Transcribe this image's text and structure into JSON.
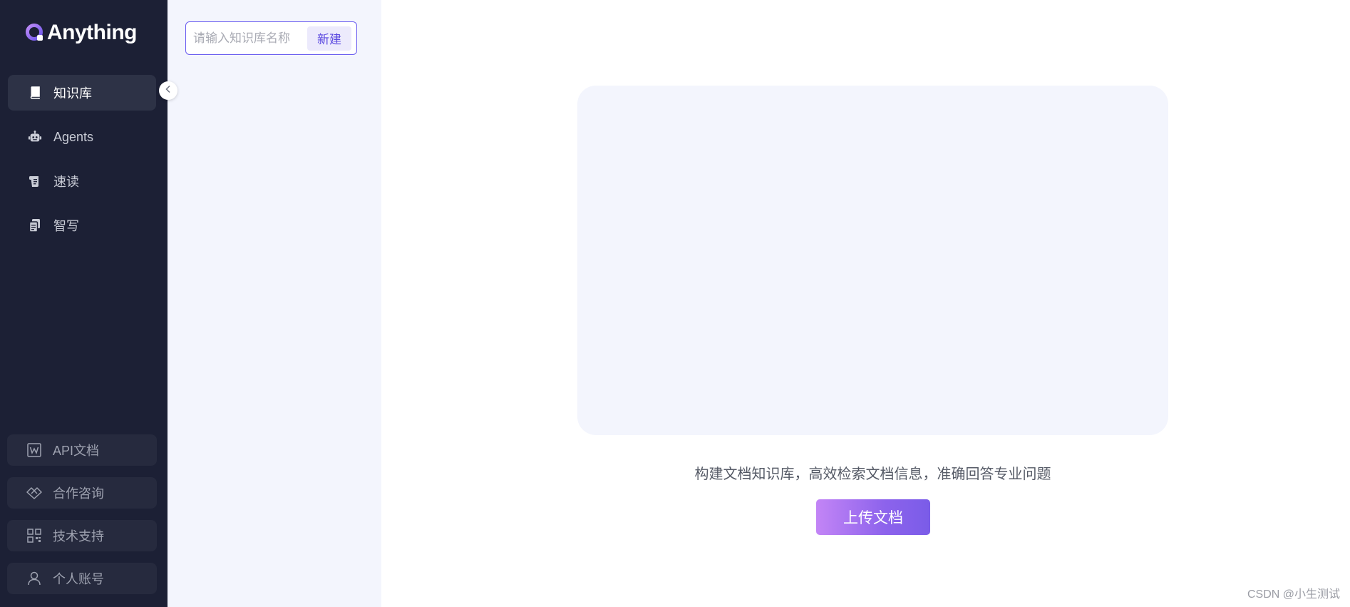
{
  "app": {
    "logo_text": "Anything",
    "brand_color": "#7a5ce8",
    "sidebar_bg": "#1c2035"
  },
  "sidebar": {
    "items": [
      {
        "label": "知识库",
        "icon": "book-icon",
        "active": true
      },
      {
        "label": "Agents",
        "icon": "robot-icon",
        "active": false
      },
      {
        "label": "速读",
        "icon": "scroll-icon",
        "active": false
      },
      {
        "label": "智写",
        "icon": "documents-icon",
        "active": false
      }
    ],
    "bottom_items": [
      {
        "label": "API文档",
        "icon": "word-doc-icon"
      },
      {
        "label": "合作咨询",
        "icon": "handshake-icon"
      },
      {
        "label": "技术支持",
        "icon": "qrcode-icon"
      },
      {
        "label": "个人账号",
        "icon": "user-icon"
      }
    ]
  },
  "kb_panel": {
    "input_placeholder": "请输入知识库名称",
    "input_value": "",
    "new_label": "新建"
  },
  "main": {
    "hint": "构建文档知识库，高效检索文档信息，准确回答专业问题",
    "upload_label": "上传文档"
  },
  "watermark": "CSDN @小生测试"
}
